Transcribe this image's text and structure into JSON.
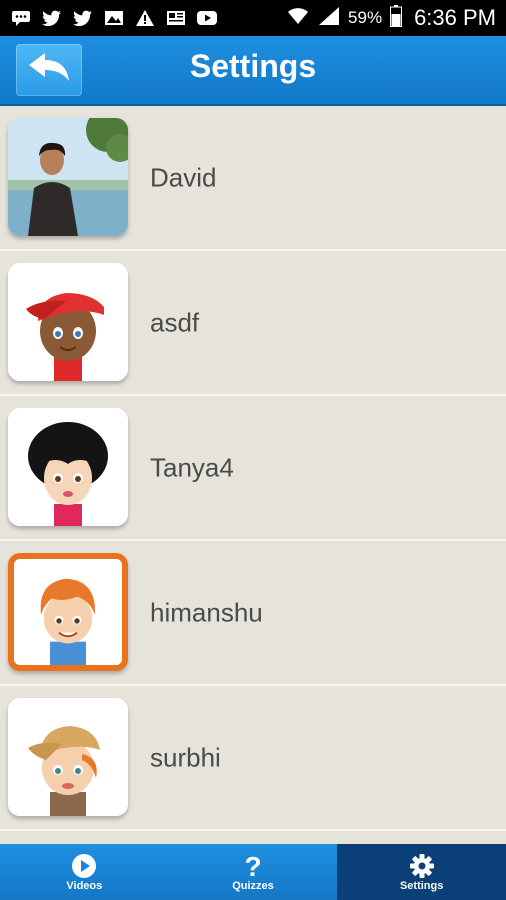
{
  "status_bar": {
    "battery": "59%",
    "time": "6:36 PM",
    "icons": [
      "message-icon",
      "twitter-icon",
      "twitter-icon",
      "image-icon",
      "warning-icon",
      "news-icon",
      "youtube-icon"
    ]
  },
  "header": {
    "title": "Settings",
    "back_icon": "back-arrow-icon"
  },
  "profiles": [
    {
      "name": "David",
      "avatar": "photo",
      "selected": false
    },
    {
      "name": "asdf",
      "avatar": "boy-red-cap",
      "selected": false
    },
    {
      "name": "Tanya4",
      "avatar": "girl-black-hair",
      "selected": false
    },
    {
      "name": "himanshu",
      "avatar": "boy-orange-hair",
      "selected": true
    },
    {
      "name": "surbhi",
      "avatar": "boy-tan-cap",
      "selected": false
    }
  ],
  "tabs": [
    {
      "label": "Videos",
      "icon": "play-icon",
      "active": false
    },
    {
      "label": "Quizzes",
      "icon": "question-icon",
      "active": false
    },
    {
      "label": "Settings",
      "icon": "gear-icon",
      "active": true
    }
  ],
  "colors": {
    "header_blue": "#1a86d8",
    "background": "#e6e4da",
    "selected_border": "#e8731e",
    "active_tab": "#0a3f78"
  }
}
